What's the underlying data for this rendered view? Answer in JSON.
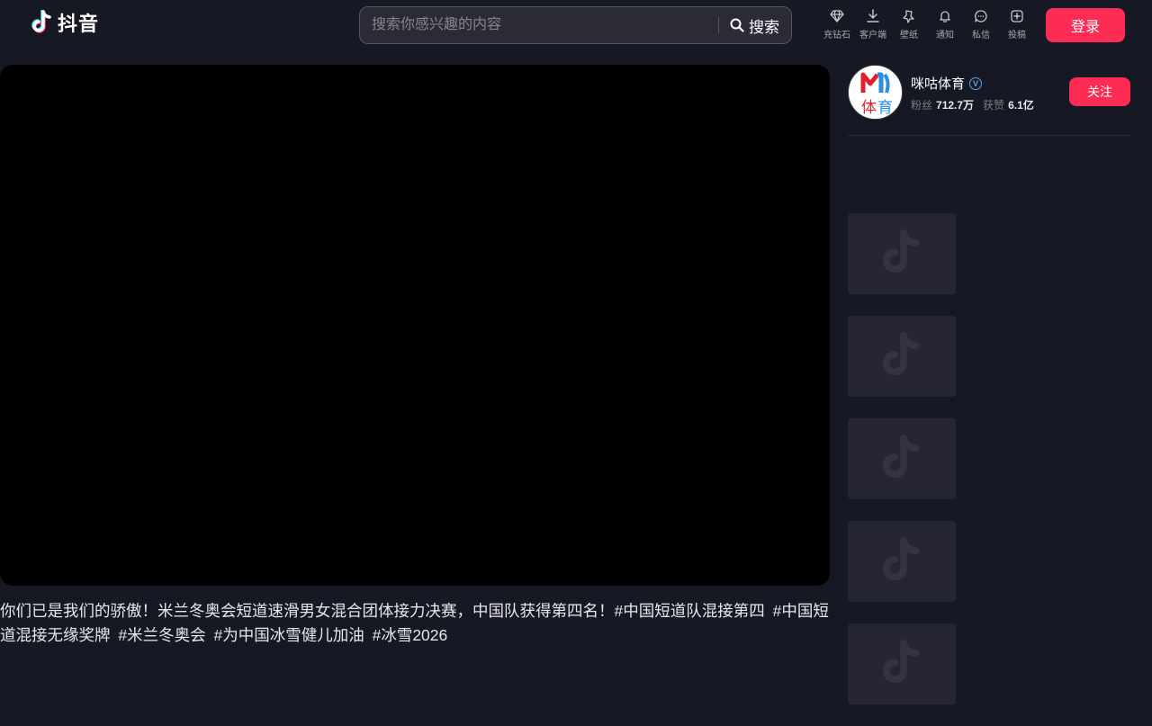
{
  "app": {
    "logo_text": "抖音"
  },
  "search": {
    "placeholder": "搜索你感兴趣的内容",
    "button_label": "搜索"
  },
  "nav": {
    "items": [
      {
        "label": "充钻石",
        "icon": "diamond-icon"
      },
      {
        "label": "客户端",
        "icon": "download-icon"
      },
      {
        "label": "壁纸",
        "icon": "wallpaper-icon"
      },
      {
        "label": "通知",
        "icon": "bell-icon"
      },
      {
        "label": "私信",
        "icon": "message-icon"
      },
      {
        "label": "投稿",
        "icon": "upload-icon"
      }
    ],
    "login_label": "登录"
  },
  "video": {
    "caption_text": "你们已是我们的骄傲！米兰冬奥会短道速滑男女混合团体接力决赛，中国队获得第四名！",
    "hashtags": [
      "#中国短道队混接第四",
      "#中国短道混接无缘奖牌",
      "#米兰冬奥会",
      "#为中国冰雪健儿加油",
      "#冰雪2026"
    ]
  },
  "author": {
    "name": "咪咕体育",
    "avatar_text": "体育",
    "fans_label": "粉丝",
    "fans_count": "712.7万",
    "likes_label": "获赞",
    "likes_count": "6.1亿",
    "follow_label": "关注"
  },
  "colors": {
    "background": "#161823",
    "accent": "#fe2c55",
    "verified": "#58a6f2",
    "thumb_placeholder": "#252632"
  }
}
